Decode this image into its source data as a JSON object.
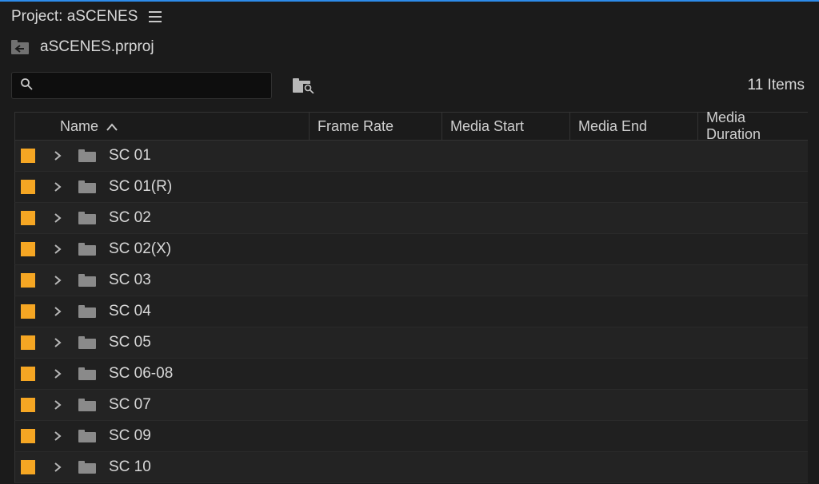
{
  "panel": {
    "title": "Project: aSCENES",
    "project_file": "aSCENES.prproj",
    "items_count_label": "11 Items"
  },
  "search": {
    "value": "",
    "placeholder": ""
  },
  "colors": {
    "accent_top": "#2d8ceb",
    "chip": "#f5a623"
  },
  "columns": {
    "name": "Name",
    "frame_rate": "Frame Rate",
    "media_start": "Media Start",
    "media_end": "Media End",
    "media_duration": "Media Duration"
  },
  "sort": {
    "column": "name",
    "direction": "asc"
  },
  "rows": [
    {
      "name": "SC 01",
      "icon": "folder-icon",
      "type": "bin"
    },
    {
      "name": "SC 01(R)",
      "icon": "folder-icon",
      "type": "bin"
    },
    {
      "name": "SC 02",
      "icon": "folder-icon",
      "type": "bin"
    },
    {
      "name": "SC 02(X)",
      "icon": "folder-icon",
      "type": "bin"
    },
    {
      "name": "SC 03",
      "icon": "folder-icon",
      "type": "bin"
    },
    {
      "name": "SC 04",
      "icon": "folder-icon",
      "type": "bin"
    },
    {
      "name": "SC 05",
      "icon": "folder-icon",
      "type": "bin"
    },
    {
      "name": "SC 06-08",
      "icon": "folder-icon",
      "type": "bin"
    },
    {
      "name": "SC 07",
      "icon": "folder-icon",
      "type": "bin"
    },
    {
      "name": "SC 09",
      "icon": "folder-icon",
      "type": "bin"
    },
    {
      "name": "SC 10",
      "icon": "folder-icon",
      "type": "bin"
    }
  ]
}
